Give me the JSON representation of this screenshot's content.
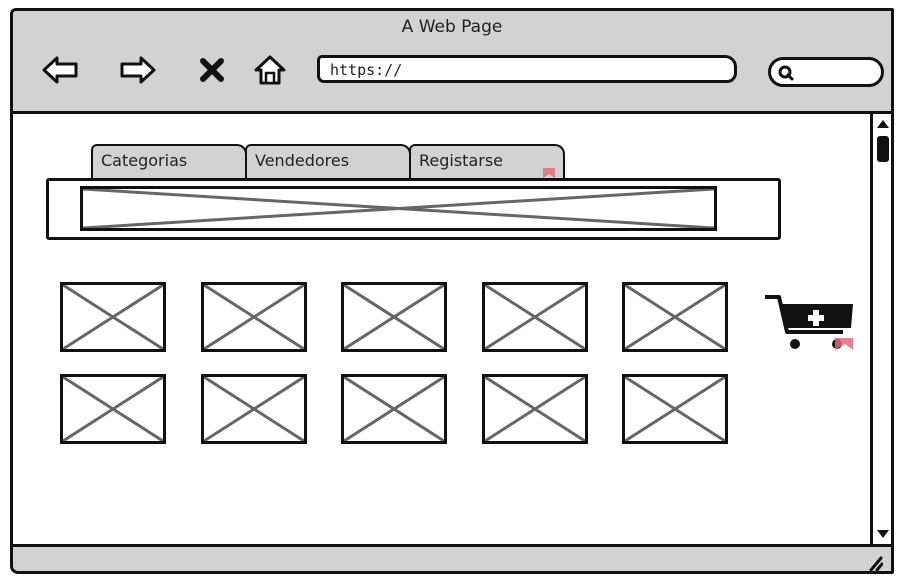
{
  "window": {
    "title": "A Web Page"
  },
  "toolbar": {
    "back_icon": "arrow-left-icon",
    "forward_icon": "arrow-right-icon",
    "stop_icon": "close-icon",
    "home_icon": "home-icon",
    "url_value": "https://",
    "search_icon": "search-icon"
  },
  "tabs": [
    {
      "label": "Categorias"
    },
    {
      "label": "Vendedores"
    },
    {
      "label": "Registarse"
    }
  ],
  "cart": {
    "icon": "add-to-cart-icon"
  },
  "product_grid": {
    "rows": 2,
    "columns": 5
  },
  "colors": {
    "chrome": "#d2d2d2",
    "outline": "#111111",
    "highlight": "#e06d7a"
  }
}
